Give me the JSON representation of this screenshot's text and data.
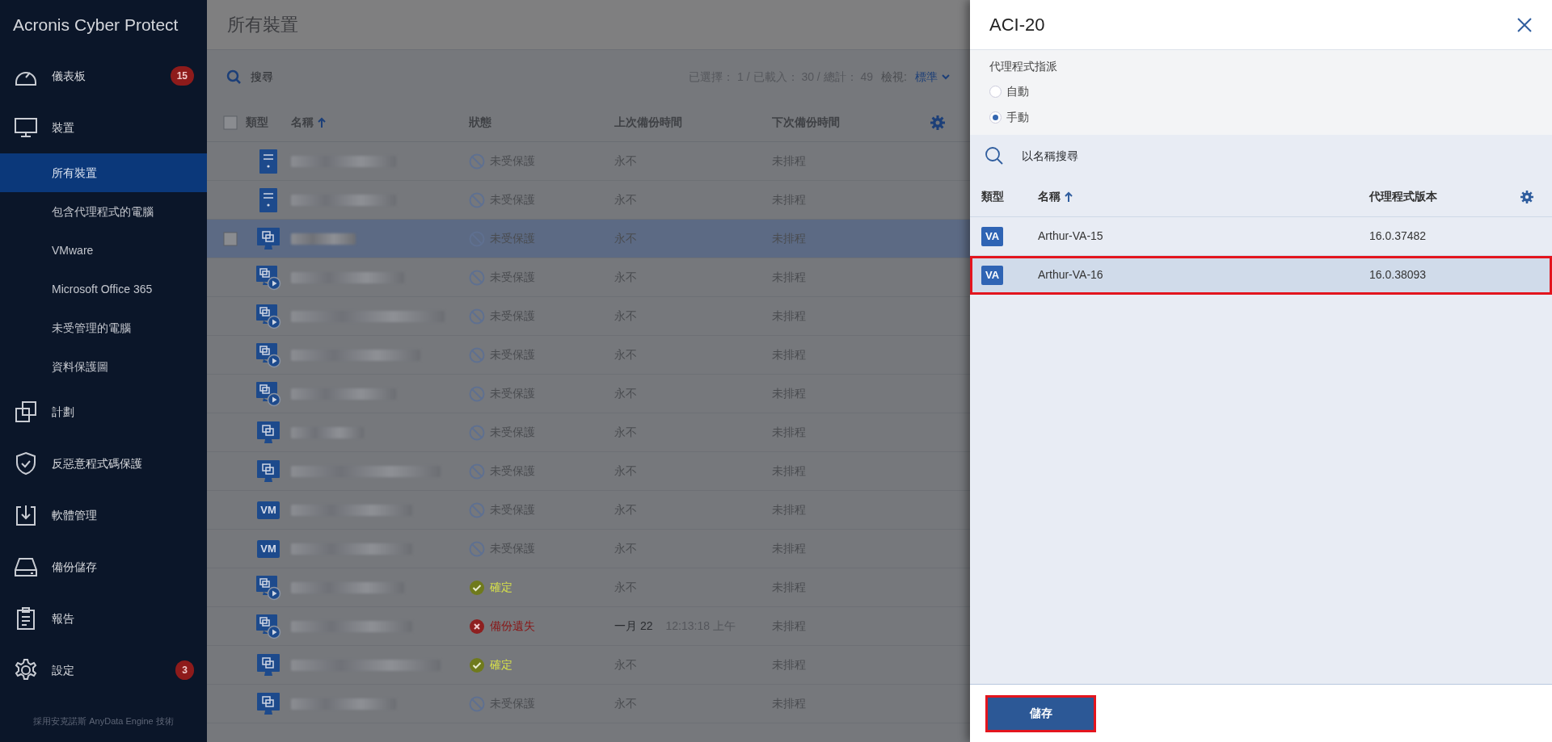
{
  "sidebar": {
    "logo": {
      "brand": "Acronis",
      "product": "Cyber Protect"
    },
    "items": [
      {
        "label": "儀表板",
        "kind": "dashboard",
        "badge": "15"
      },
      {
        "label": "裝置",
        "kind": "monitor",
        "children": [
          {
            "label": "所有裝置",
            "selected": true
          },
          {
            "label": "包含代理程式的電腦",
            "selected": false
          },
          {
            "label": "VMware",
            "selected": false
          },
          {
            "label": "Microsoft Office 365",
            "selected": false
          },
          {
            "label": "未受管理的電腦",
            "selected": false
          },
          {
            "label": "資料保護圖",
            "selected": false
          }
        ]
      },
      {
        "label": "計劃",
        "kind": "plans"
      },
      {
        "label": "反惡意程式碼保護",
        "kind": "shield"
      },
      {
        "label": "軟體管理",
        "kind": "download"
      },
      {
        "label": "備份儲存",
        "kind": "drive"
      },
      {
        "label": "報告",
        "kind": "clipboard"
      },
      {
        "label": "設定",
        "kind": "gear",
        "badge": "3"
      }
    ],
    "footer": "採用安克諾斯 AnyData Engine 技術"
  },
  "main": {
    "title": "所有裝置",
    "search": {
      "placeholder": "搜尋"
    },
    "summary": "已選擇： 1 / 已載入： 30 / 總計： 49",
    "view_label": "檢視:",
    "view_value": "標準",
    "select_all_checked": false,
    "columns": [
      {
        "label": "類型",
        "sorted": false
      },
      {
        "label": "名稱",
        "sorted": true
      },
      {
        "label": "狀態",
        "sorted": false
      },
      {
        "label": "上次備份時間",
        "sorted": false
      },
      {
        "label": "下次備份時間",
        "sorted": false
      }
    ],
    "rows": [
      {
        "kind": "server",
        "selected": false,
        "status": {
          "kind": "unprotected",
          "label": "未受保護"
        },
        "last_backup": "永不",
        "next_backup": "未排程"
      },
      {
        "kind": "server",
        "selected": false,
        "status": {
          "kind": "unprotected",
          "label": "未受保護"
        },
        "last_backup": "永不",
        "next_backup": "未排程"
      },
      {
        "kind": "multi",
        "selected": true,
        "status": {
          "kind": "unprotected",
          "label": "未受保護"
        },
        "last_backup": "永不",
        "next_backup": "未排程"
      },
      {
        "kind": "play",
        "selected": false,
        "status": {
          "kind": "unprotected",
          "label": "未受保護"
        },
        "last_backup": "永不",
        "next_backup": "未排程"
      },
      {
        "kind": "play",
        "selected": false,
        "status": {
          "kind": "unprotected",
          "label": "未受保護"
        },
        "last_backup": "永不",
        "next_backup": "未排程"
      },
      {
        "kind": "play",
        "selected": false,
        "status": {
          "kind": "unprotected",
          "label": "未受保護"
        },
        "last_backup": "永不",
        "next_backup": "未排程"
      },
      {
        "kind": "play",
        "selected": false,
        "status": {
          "kind": "unprotected",
          "label": "未受保護"
        },
        "last_backup": "永不",
        "next_backup": "未排程"
      },
      {
        "kind": "multi",
        "selected": false,
        "status": {
          "kind": "unprotected",
          "label": "未受保護"
        },
        "last_backup": "永不",
        "next_backup": "未排程"
      },
      {
        "kind": "multi",
        "selected": false,
        "status": {
          "kind": "unprotected",
          "label": "未受保護"
        },
        "last_backup": "永不",
        "next_backup": "未排程"
      },
      {
        "kind": "vm",
        "icon_text": "VM",
        "selected": false,
        "status": {
          "kind": "unprotected",
          "label": "未受保護"
        },
        "last_backup": "永不",
        "next_backup": "未排程"
      },
      {
        "kind": "vm",
        "icon_text": "VM",
        "selected": false,
        "status": {
          "kind": "unprotected",
          "label": "未受保護"
        },
        "last_backup": "永不",
        "next_backup": "未排程"
      },
      {
        "kind": "play",
        "selected": false,
        "status": {
          "kind": "ok",
          "label": "確定"
        },
        "last_backup": "永不",
        "next_backup": "未排程"
      },
      {
        "kind": "play",
        "selected": false,
        "status": {
          "kind": "error",
          "label": "備份遺失"
        },
        "last_backup": "一月 22",
        "last_backup_time": "12:13:18 上午",
        "next_backup": "未排程"
      },
      {
        "kind": "multi",
        "selected": false,
        "status": {
          "kind": "ok",
          "label": "確定"
        },
        "last_backup": "永不",
        "next_backup": "未排程"
      },
      {
        "kind": "multi",
        "selected": false,
        "status": {
          "kind": "unprotected",
          "label": "未受保護"
        },
        "last_backup": "永不",
        "next_backup": "未排程"
      }
    ]
  },
  "panel": {
    "title": "ACI-20",
    "assignment": {
      "label": "代理程式指派",
      "options": [
        {
          "label": "自動",
          "selected": false
        },
        {
          "label": "手動",
          "selected": true
        }
      ]
    },
    "search": {
      "placeholder": "以名稱搜尋"
    },
    "columns": [
      {
        "label": "類型",
        "sorted": false
      },
      {
        "label": "名稱",
        "sorted": true
      },
      {
        "label": "代理程式版本",
        "sorted": false
      }
    ],
    "rows": [
      {
        "icon_text": "VA",
        "name": "Arthur-VA-15",
        "version": "16.0.37482",
        "selected": false,
        "highlighted": false
      },
      {
        "icon_text": "VA",
        "name": "Arthur-VA-16",
        "version": "16.0.38093",
        "selected": true,
        "highlighted": true
      }
    ],
    "save_button": {
      "label": "儲存",
      "highlighted": true
    }
  }
}
